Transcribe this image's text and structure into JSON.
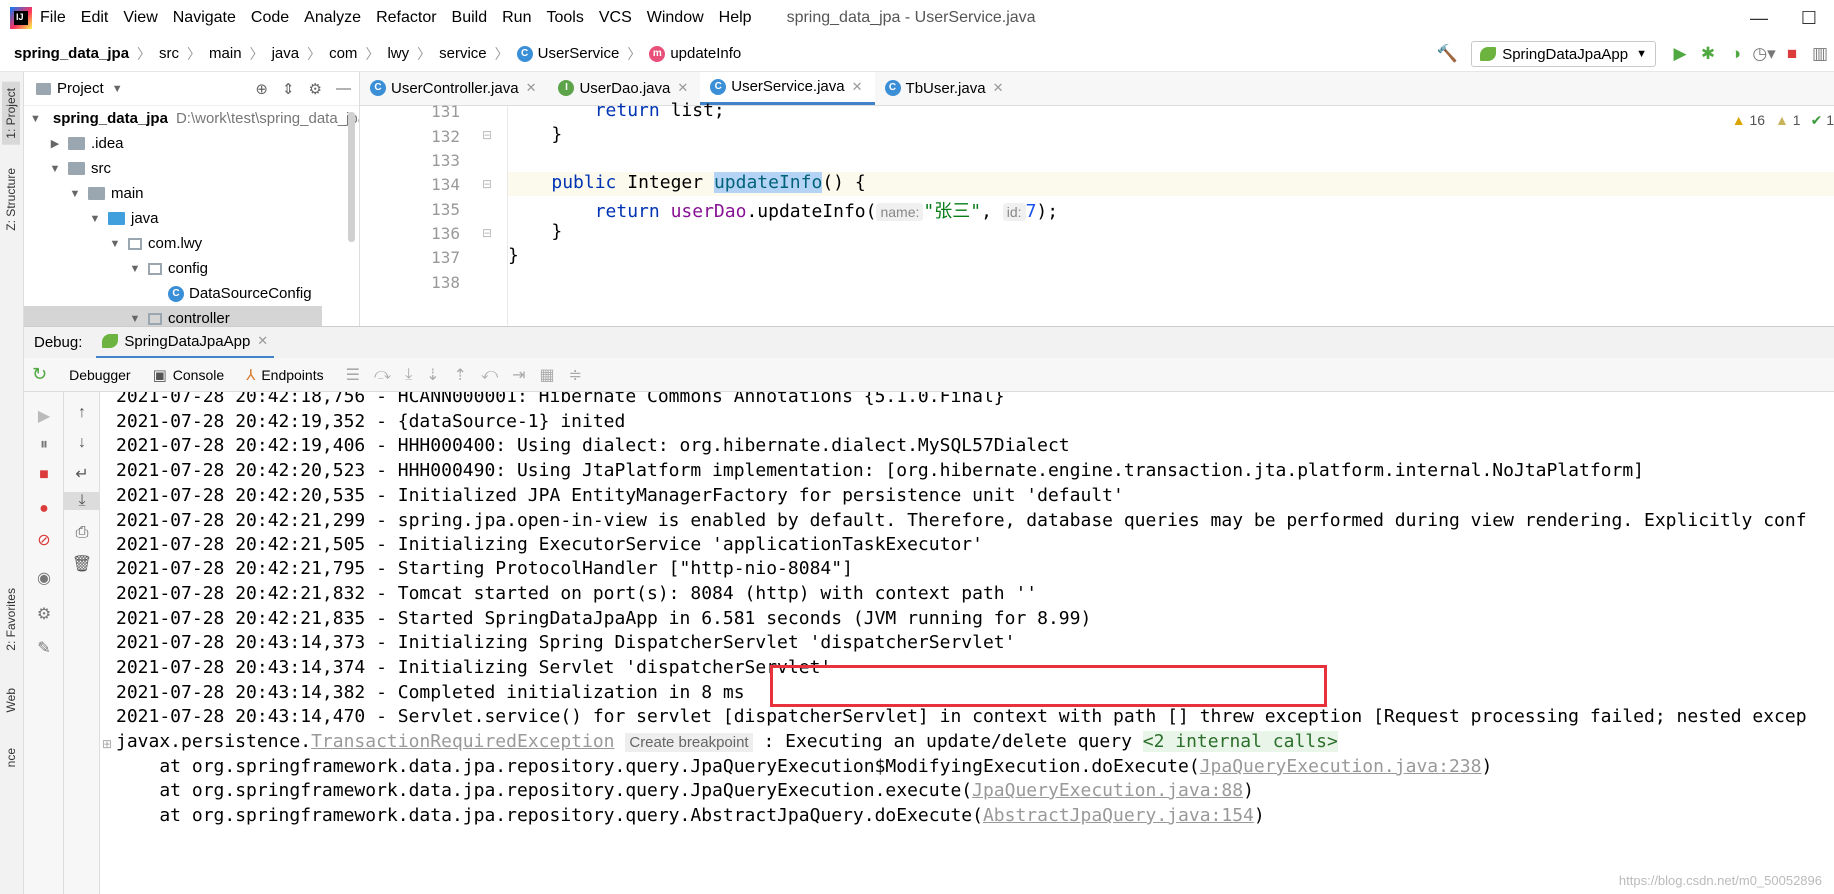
{
  "menubar": {
    "items": [
      "File",
      "Edit",
      "View",
      "Navigate",
      "Code",
      "Analyze",
      "Refactor",
      "Build",
      "Run",
      "Tools",
      "VCS",
      "Window",
      "Help"
    ],
    "title": "spring_data_jpa - UserService.java"
  },
  "breadcrumb": {
    "items": [
      "spring_data_jpa",
      "src",
      "main",
      "java",
      "com",
      "lwy",
      "service",
      "UserService",
      "updateInfo"
    ]
  },
  "toolbar": {
    "run_config": "SpringDataJpaApp"
  },
  "left_stripe": {
    "project": "1: Project",
    "structure": "Z: Structure",
    "favorites": "2: Favorites",
    "web": "Web",
    "nce": "nce"
  },
  "project_panel": {
    "title": "Project",
    "tree": [
      {
        "label": "spring_data_jpa",
        "hint": "D:\\work\\test\\spring_data_jpa"
      },
      {
        "label": ".idea"
      },
      {
        "label": "src"
      },
      {
        "label": "main"
      },
      {
        "label": "java"
      },
      {
        "label": "com.lwy"
      },
      {
        "label": "config"
      },
      {
        "label": "DataSourceConfig"
      },
      {
        "label": "controller"
      }
    ]
  },
  "editor": {
    "tabs": [
      {
        "label": "UserController.java",
        "icon": "C"
      },
      {
        "label": "UserDao.java",
        "icon": "I"
      },
      {
        "label": "UserService.java",
        "icon": "C"
      },
      {
        "label": "TbUser.java",
        "icon": "C"
      }
    ],
    "line_numbers": [
      "131",
      "132",
      "133",
      "134",
      "135",
      "136",
      "137",
      "138"
    ],
    "code": {
      "l131_kw": "return",
      "l131_rest": " list;",
      "l132": "}",
      "l134_kw": "public",
      "l134_type": " Integer ",
      "l134_name": "updateInfo",
      "l134_rest": "() {",
      "l135_kw": "return",
      "l135_field": "userDao",
      "l135_call": ".updateInfo(",
      "l135_hint1": "name:",
      "l135_str": "\"张三\"",
      "l135_comma": ",",
      "l135_hint2": "id:",
      "l135_num": "7",
      "l135_end": ");",
      "l136": "}",
      "l137": "}"
    },
    "warnings": {
      "yellow": "16",
      "weak": "1",
      "ok": "1"
    }
  },
  "debug": {
    "label": "Debug:",
    "session": "SpringDataJpaApp",
    "tabs": [
      "Debugger",
      "Console",
      "Endpoints"
    ]
  },
  "console": {
    "lines": [
      "2021-07-28 20:42:18,756 - HCANN000001: Hibernate Commons Annotations {5.1.0.Final}",
      "2021-07-28 20:42:19,352 - {dataSource-1} inited",
      "2021-07-28 20:42:19,406 - HHH000400: Using dialect: org.hibernate.dialect.MySQL57Dialect",
      "2021-07-28 20:42:20,523 - HHH000490: Using JtaPlatform implementation: [org.hibernate.engine.transaction.jta.platform.internal.NoJtaPlatform]",
      "2021-07-28 20:42:20,535 - Initialized JPA EntityManagerFactory for persistence unit 'default'",
      "2021-07-28 20:42:21,299 - spring.jpa.open-in-view is enabled by default. Therefore, database queries may be performed during view rendering. Explicitly conf",
      "2021-07-28 20:42:21,505 - Initializing ExecutorService 'applicationTaskExecutor'",
      "2021-07-28 20:42:21,795 - Starting ProtocolHandler [\"http-nio-8084\"]",
      "2021-07-28 20:42:21,832 - Tomcat started on port(s): 8084 (http) with context path ''",
      "2021-07-28 20:42:21,835 - Started SpringDataJpaApp in 6.581 seconds (JVM running for 8.99)",
      "2021-07-28 20:43:14,373 - Initializing Spring DispatcherServlet 'dispatcherServlet'",
      "2021-07-28 20:43:14,374 - Initializing Servlet 'dispatcherServlet'",
      "2021-07-28 20:43:14,382 - Completed initialization in 8 ms",
      "2021-07-28 20:43:14,470 - Servlet.service() for servlet [dispatcherServlet] in context with path [] threw exception [Request processing failed; nested excep"
    ],
    "exception": {
      "prefix": "javax.persistence.",
      "class": "TransactionRequiredException",
      "breakpoint": "Create breakpoint",
      "message": ": Executing an update/delete query ",
      "internal": "<2 internal calls>"
    },
    "stack": [
      {
        "prefix": "    at org.springframework.data.jpa.repository.query.JpaQueryExecution$ModifyingExecution.doExecute(",
        "link": "JpaQueryExecution.java:238",
        "suffix": ")"
      },
      {
        "prefix": "    at org.springframework.data.jpa.repository.query.JpaQueryExecution.execute(",
        "link": "JpaQueryExecution.java:88",
        "suffix": ")"
      },
      {
        "prefix": "    at org.springframework.data.jpa.repository.query.AbstractJpaQuery.doExecute(",
        "link": "AbstractJpaQuery.java:154",
        "suffix": ")"
      }
    ],
    "watermark": "https://blog.csdn.net/m0_50052896"
  },
  "colors": {
    "accent": "#4083c9",
    "highlight_box": "#e8323b"
  }
}
